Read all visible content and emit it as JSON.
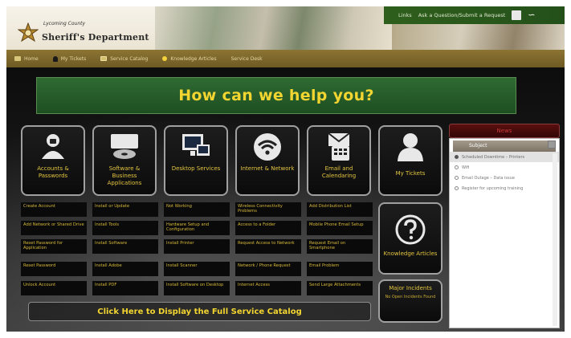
{
  "header": {
    "dept_line1": "Lycoming County",
    "dept_name": "Sheriff's Department",
    "top_links": {
      "user_label": "Links",
      "user_menu": "Ask a Question/Submit a Request",
      "logo_swoosh": "∽"
    }
  },
  "nav": {
    "items": [
      {
        "label": "Home",
        "icon": "home-icon"
      },
      {
        "label": "My Tickets",
        "icon": "person-icon"
      },
      {
        "label": "Service Catalog",
        "icon": "calendar-icon"
      },
      {
        "label": "Knowledge Articles",
        "icon": "lightbulb-icon"
      },
      {
        "label": "Service Desk",
        "icon": "none"
      }
    ]
  },
  "banner": {
    "title": "How can we help you?"
  },
  "categories": [
    {
      "label": "Accounts & Passwords",
      "icon": "person-lock-icon"
    },
    {
      "label": "Software & Business Applications",
      "icon": "monitor-disc-icon"
    },
    {
      "label": "Desktop Services",
      "icon": "desktop-icon"
    },
    {
      "label": "Internet & Network",
      "icon": "wifi-icon"
    },
    {
      "label": "Email and Calendaring",
      "icon": "phone-mail-icon"
    },
    {
      "label": "My Tickets",
      "icon": "user-silhouette-icon"
    }
  ],
  "links": [
    [
      "Create Account",
      "Install or Update",
      "Not Working",
      "Wireless Connectivity Problems",
      "Add Distribution List"
    ],
    [
      "Add Network or Shared Drive",
      "Install Tools",
      "Hardware Setup and Configuration",
      "Access to a Folder",
      "Mobile Phone Email Setup"
    ],
    [
      "Reset Password for Application",
      "Install Software",
      "Install Printer",
      "Request Access to Network",
      "Request Email on Smartphone"
    ],
    [
      "Reset Password",
      "Install Adobe",
      "Install Scanner",
      "Network / Phone Request",
      "Email Problem"
    ],
    [
      "Unlock Account",
      "Install PDF",
      "Install Software on Desktop",
      "Internet Access",
      "Send Large Attachments"
    ]
  ],
  "side_tiles": {
    "knowledge": {
      "label": "Knowledge Articles",
      "icon": "question-mark-icon"
    },
    "announcements": {
      "label": "Major Incidents",
      "sub": "No Open Incidents Found"
    }
  },
  "catalog_button": "Click Here to Display the Full Service Catalog",
  "news": {
    "header": "News",
    "subject_label": "Subject",
    "items": [
      {
        "text": "Scheduled Downtime – Printers",
        "selected": true
      },
      {
        "text": "Wifi",
        "selected": false
      },
      {
        "text": "Email Outage – Data issue",
        "selected": false
      },
      {
        "text": "Register for upcoming training",
        "selected": false
      }
    ]
  },
  "colors": {
    "accent_yellow": "#f2d530",
    "banner_green": "#1e4f22",
    "nav_brown": "#6e5a24"
  }
}
